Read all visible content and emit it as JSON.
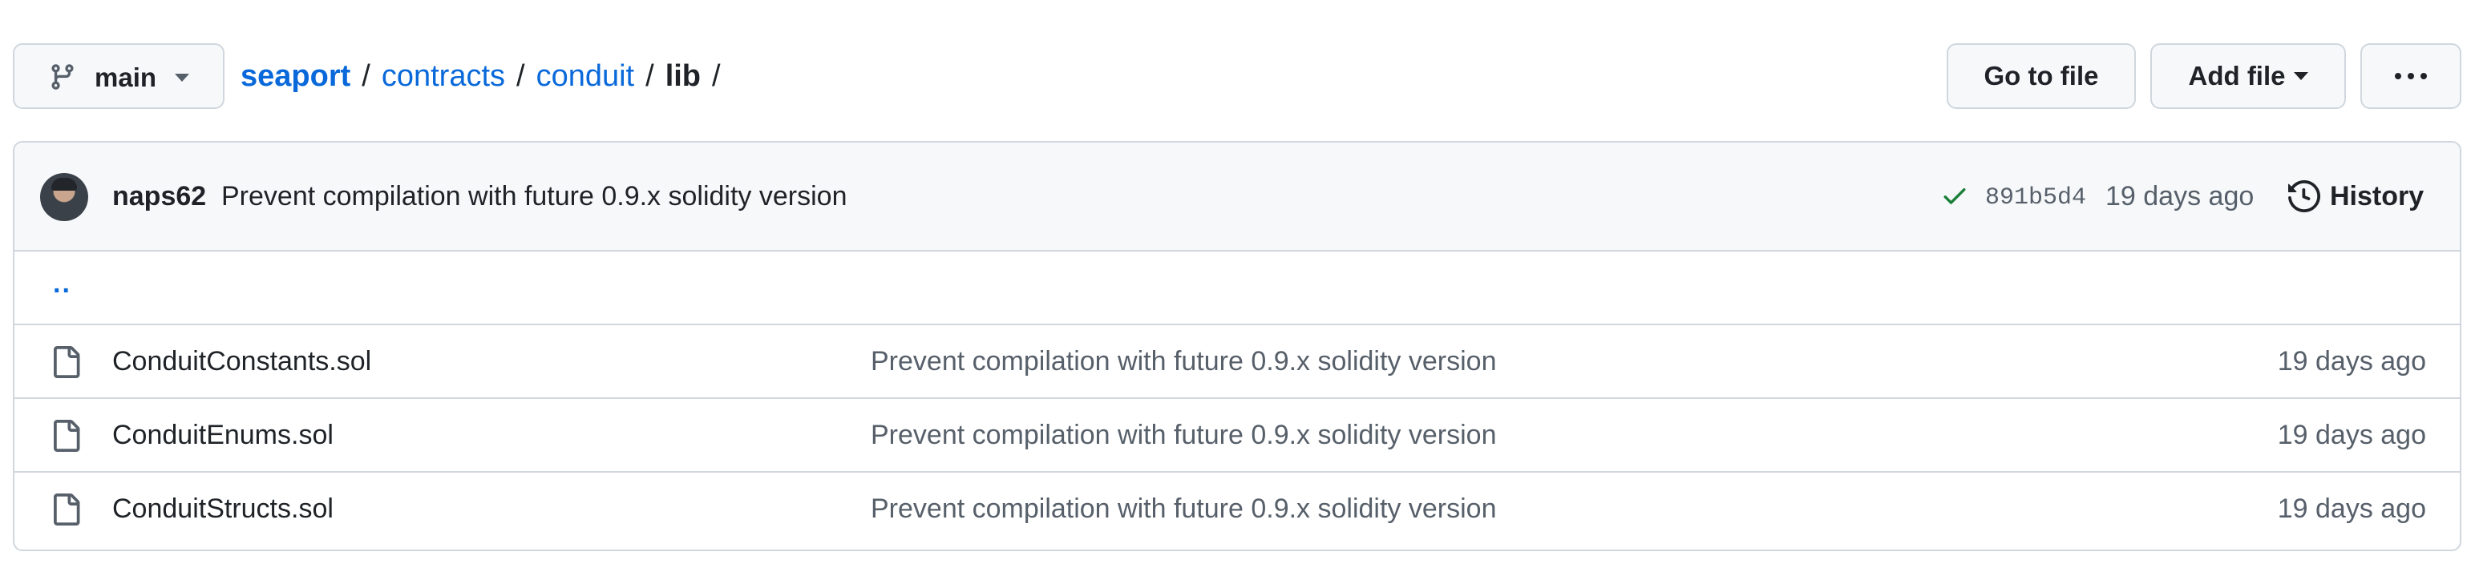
{
  "branch": {
    "name": "main",
    "icon": "git-branch-icon"
  },
  "breadcrumb": {
    "root": "seaport",
    "segments": [
      "contracts",
      "conduit"
    ],
    "current": "lib",
    "separator": "/"
  },
  "actions": {
    "go_to_file": "Go to file",
    "add_file": "Add file",
    "more": "kebab-horizontal-icon"
  },
  "latest_commit": {
    "author": "naps62",
    "message": "Prevent compilation with future 0.9.x solidity version",
    "status": "success",
    "sha": "891b5d4",
    "age": "19 days ago",
    "history_label": "History"
  },
  "parent_dir": "..",
  "files": [
    {
      "name": "ConduitConstants.sol",
      "message": "Prevent compilation with future 0.9.x solidity version",
      "age": "19 days ago"
    },
    {
      "name": "ConduitEnums.sol",
      "message": "Prevent compilation with future 0.9.x solidity version",
      "age": "19 days ago"
    },
    {
      "name": "ConduitStructs.sol",
      "message": "Prevent compilation with future 0.9.x solidity version",
      "age": "19 days ago"
    }
  ],
  "colors": {
    "link": "#0969da",
    "text": "#1f2328",
    "muted": "#57606a",
    "border": "#d0d7de",
    "header_bg": "#f6f8fa",
    "success": "#1a7f37"
  }
}
